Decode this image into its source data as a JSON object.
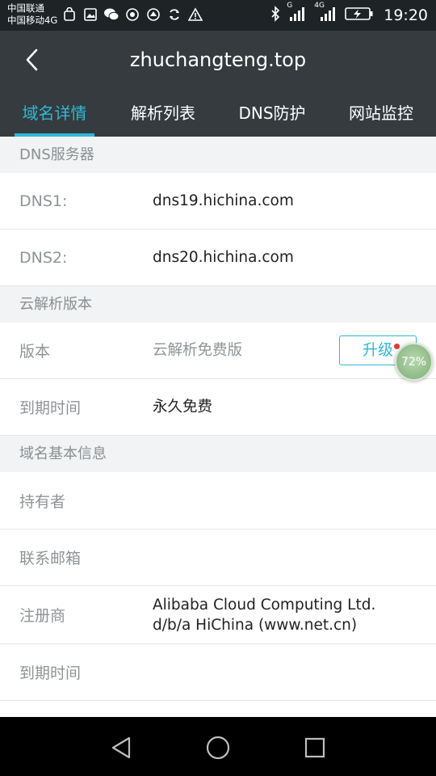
{
  "status_bar": {
    "carrier1": "中国联通",
    "carrier2": "中国移动4G",
    "network_label_g": "G",
    "network_label_4g": "4G",
    "time": "19:20"
  },
  "header": {
    "title": "zhuchangteng.top",
    "tabs": [
      {
        "label": "域名详情",
        "active": true
      },
      {
        "label": "解析列表",
        "active": false
      },
      {
        "label": "DNS防护",
        "active": false
      },
      {
        "label": "网站监控",
        "active": false
      }
    ]
  },
  "dns_section": {
    "heading": "DNS服务器",
    "rows": [
      {
        "label": "DNS1:",
        "value": "dns19.hichina.com"
      },
      {
        "label": "DNS2:",
        "value": "dns20.hichina.com"
      }
    ]
  },
  "version_section": {
    "heading": "云解析版本",
    "version_label": "版本",
    "version_value": "云解析免费版",
    "upgrade_label": "升级",
    "expiry_label": "到期时间",
    "expiry_value": "永久免费"
  },
  "basic_section": {
    "heading": "域名基本信息",
    "rows": [
      {
        "label": "持有者",
        "value": ""
      },
      {
        "label": "联系邮箱",
        "value": ""
      },
      {
        "label": "注册商",
        "value": "Alibaba Cloud Computing Ltd. d/b/a HiChina (www.net.cn)"
      },
      {
        "label": "到期时间",
        "value": ""
      }
    ]
  },
  "floating_widget": {
    "text": "72%"
  },
  "colors": {
    "accent": "#2fb9d6",
    "header_bg": "#353b3f",
    "status_bg": "#1e2326",
    "section_bg": "#f2f3f4"
  }
}
